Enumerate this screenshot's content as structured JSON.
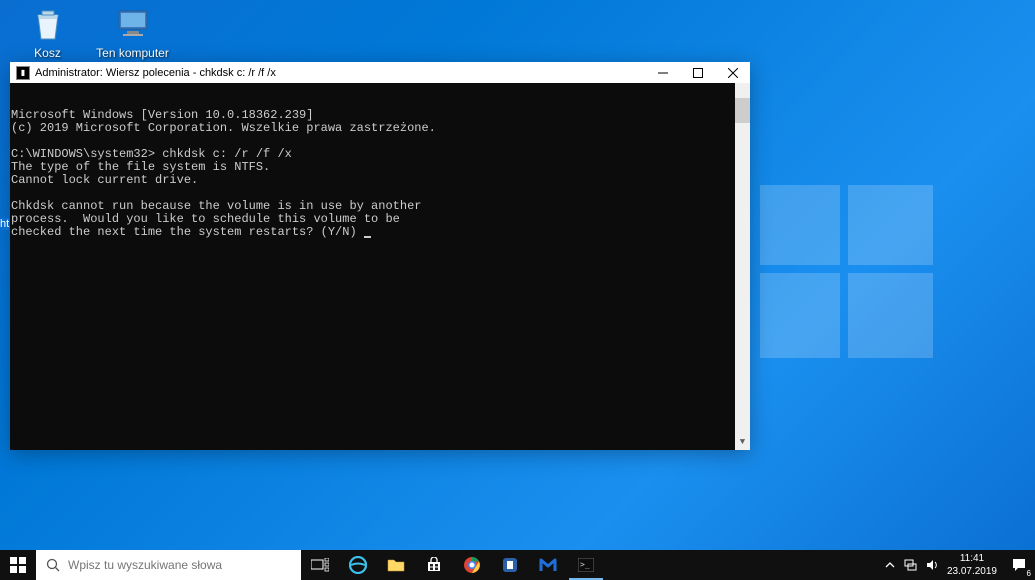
{
  "desktop": {
    "icons": [
      {
        "name": "recycle-bin",
        "label": "Kosz"
      },
      {
        "name": "this-pc",
        "label": "Ten komputer"
      }
    ]
  },
  "window": {
    "title": "Administrator: Wiersz polecenia - chkdsk  c: /r /f /x",
    "lines": {
      "l1": "Microsoft Windows [Version 10.0.18362.239]",
      "l2": "(c) 2019 Microsoft Corporation. Wszelkie prawa zastrzeżone.",
      "l3": "",
      "l4": "C:\\WINDOWS\\system32> chkdsk c: /r /f /x",
      "l5": "The type of the file system is NTFS.",
      "l6": "Cannot lock current drive.",
      "l7": "",
      "l8": "Chkdsk cannot run because the volume is in use by another",
      "l9": "process.  Would you like to schedule this volume to be",
      "l10": "checked the next time the system restarts? (Y/N) "
    }
  },
  "selection_artifact": "ht",
  "taskbar": {
    "search_placeholder": "Wpisz tu wyszukiwane słowa",
    "clock_time": "11:41",
    "clock_date": "23.07.2019",
    "notification_count": "6"
  }
}
